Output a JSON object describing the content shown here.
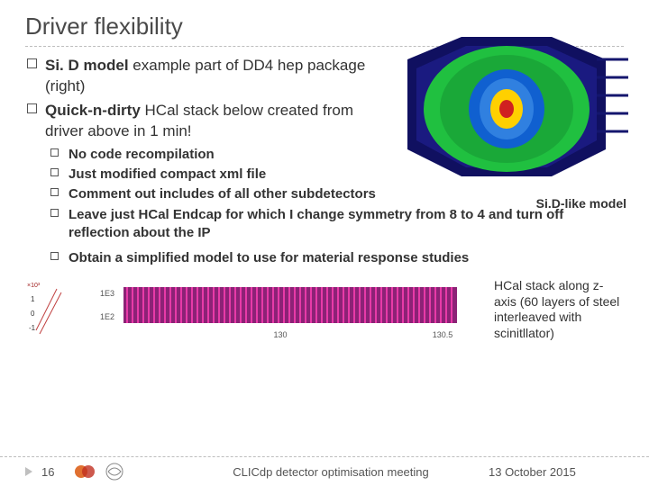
{
  "title": "Driver flexibility",
  "bullets_l1": [
    {
      "lead": "Si. D model",
      "rest": " example part of DD4 hep package (right)"
    },
    {
      "lead": "Quick-n-dirty",
      "rest": " HCal stack below created from driver above in 1 min!"
    }
  ],
  "bullets_l2": [
    {
      "lead": "No",
      "rest": " code recompilation"
    },
    {
      "lead": "Just",
      "rest": " modified compact xml file"
    },
    {
      "lead": "Comment",
      "rest": " out includes of all other subdetectors"
    },
    {
      "lead": "Leave",
      "rest": " just HCal Endcap for which I change symmetry from 8 to 4 and turn off reflection about the IP"
    },
    {
      "lead": "Obtain",
      "rest": " a simplified model to use for material response studies"
    }
  ],
  "detector_caption": "Si.D-like model",
  "hcal_caption": "HCal stack along z-axis (60 layers of steel interleaved with scinitllator)",
  "hcal_axis": {
    "y_ticks": [
      "1E3",
      "1E2"
    ],
    "x_ticks": [
      "130",
      "130.5"
    ]
  },
  "hcal_left_plot": {
    "y_ticks": [
      "×10³",
      "1",
      "0",
      "-1"
    ]
  },
  "footer": {
    "page": "16",
    "meeting": "CLICdp detector optimisation meeting",
    "date": "13 October 2015"
  },
  "colors": {
    "detector_outer": "#0a0a5a",
    "detector_inner": "#20c040",
    "detector_core1": "#1060d0",
    "detector_core2": "#ffd000",
    "detector_core3": "#d02020",
    "hcal_bar": "#a02080",
    "hcal_layer": "#cc2080"
  }
}
